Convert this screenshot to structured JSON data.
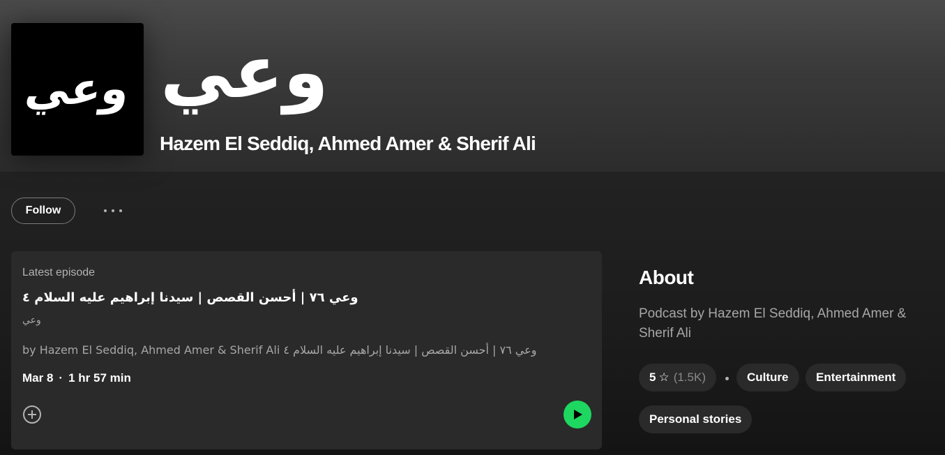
{
  "podcast": {
    "cover_text": "وعي",
    "title": "وعي",
    "authors": "Hazem El Seddiq, Ahmed Amer & Sherif Ali"
  },
  "actions": {
    "follow_label": "Follow",
    "more_icon": "more-options-icon"
  },
  "episode": {
    "section_label": "Latest episode",
    "title": "وعي ٧٦ | أحسن القصص | سيدنا إبراهيم عليه السلام ٤",
    "show": "وعي",
    "description": "وعي ٧٦ | أحسن القصص | سيدنا إبراهيم عليه السلام ٤ by Hazem El Seddiq, Ahmed Amer & Sherif Ali",
    "date": "Mar 8",
    "separator": "·",
    "duration": "1 hr 57 min",
    "add_icon": "add-circle-icon",
    "play_icon": "play-icon",
    "play_color": "#1ed760"
  },
  "about": {
    "heading": "About",
    "description": "Podcast by Hazem El Seddiq, Ahmed Amer & Sherif Ali",
    "rating": "5",
    "rating_icon": "star-icon",
    "rating_count": "(1.5K)",
    "categories": [
      "Culture",
      "Entertainment",
      "Personal stories"
    ]
  }
}
